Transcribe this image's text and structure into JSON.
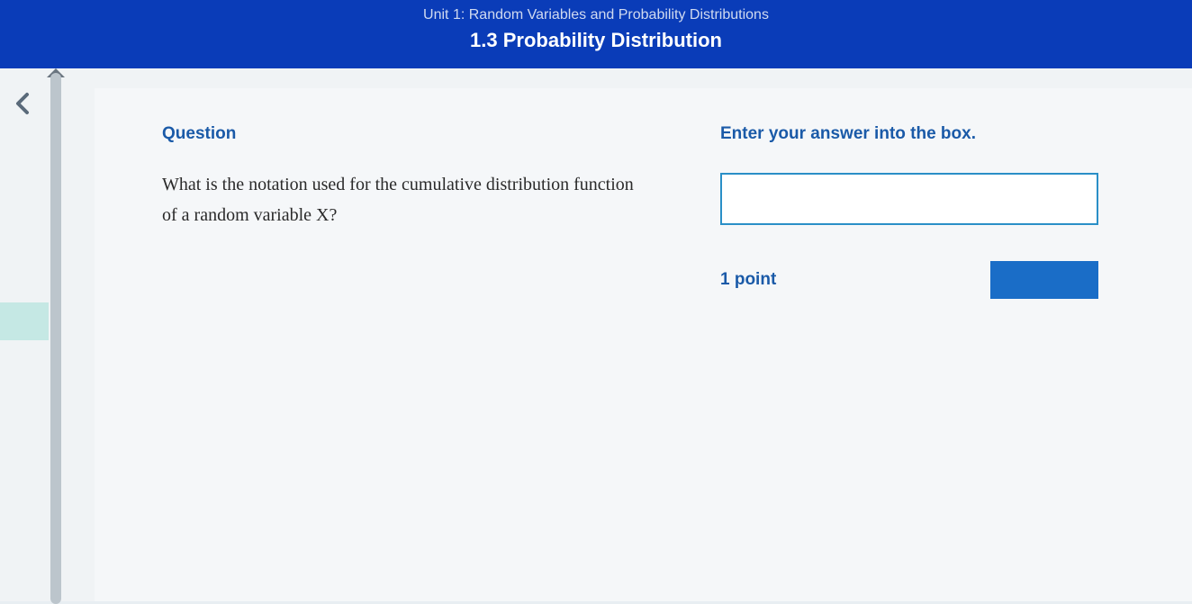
{
  "header": {
    "unit": "Unit 1: Random Variables and Probability Distributions",
    "section": "1.3 Probability Distribution"
  },
  "question": {
    "label": "Question",
    "text": "What is the notation used for the cumulative distribution function of a random variable X?"
  },
  "answer": {
    "label": "Enter your answer into the box.",
    "value": "",
    "placeholder": ""
  },
  "points": {
    "label": "1 point"
  }
}
